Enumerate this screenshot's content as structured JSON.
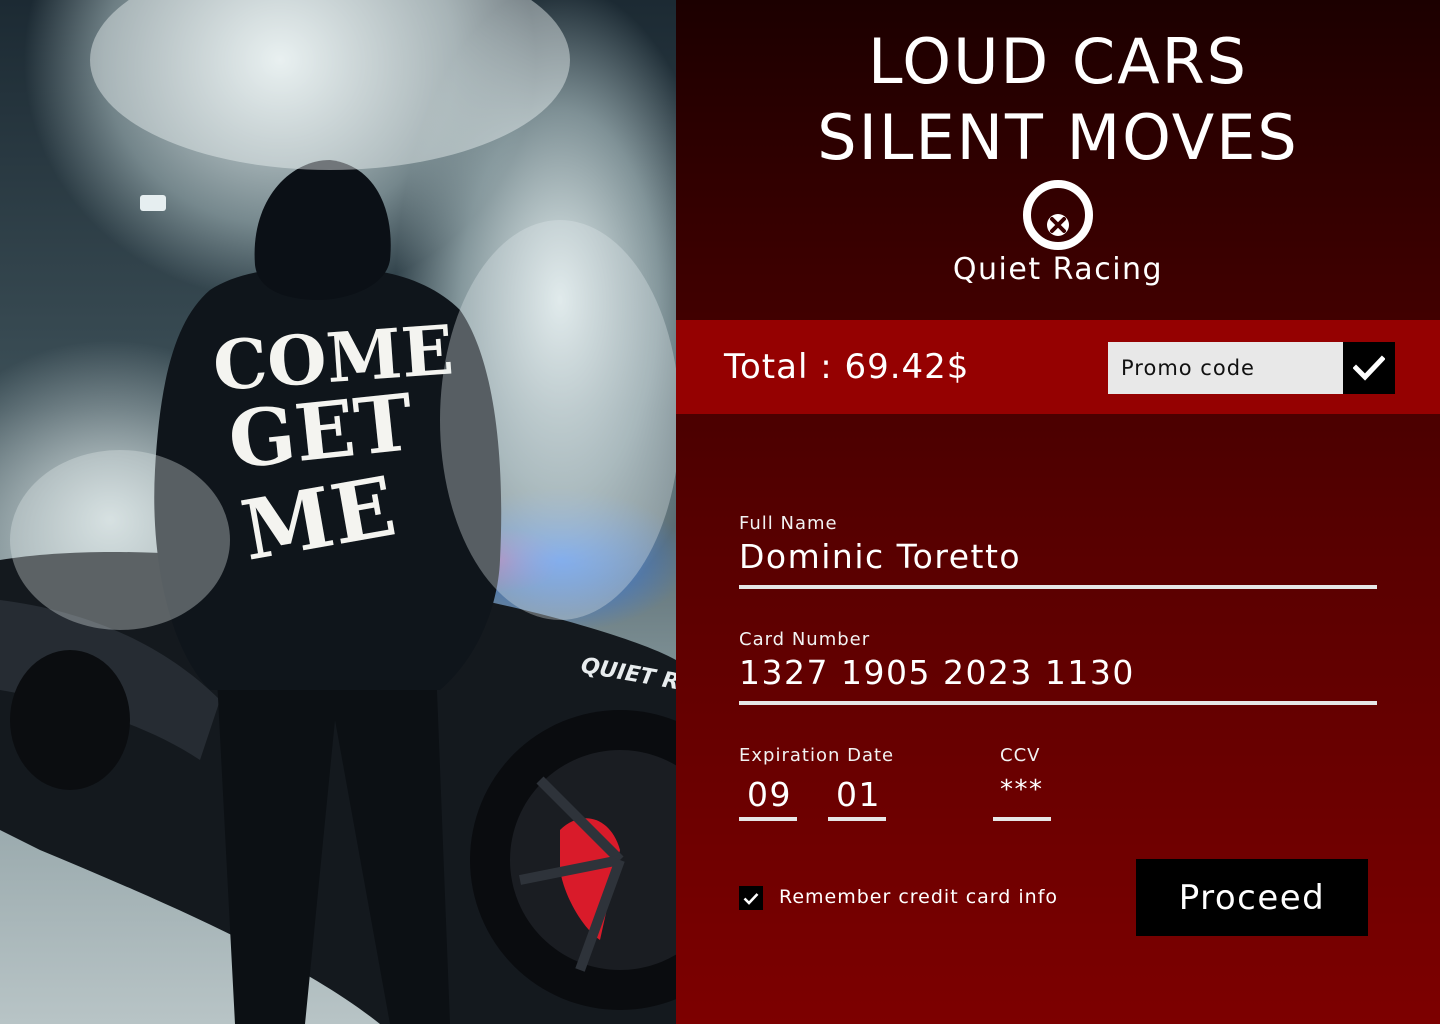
{
  "headline": {
    "line1": "LOUD CARS",
    "line2": "SILENT MOVES"
  },
  "brand": {
    "name": "Quiet Racing",
    "logo_icon": "mouth-x-icon"
  },
  "photo": {
    "hoodie_print": [
      "COME",
      "GET",
      "ME"
    ],
    "car_decal": "QUIET RAC"
  },
  "order": {
    "total_label": "Total : 69.42$"
  },
  "promo": {
    "placeholder": "Promo code",
    "apply_icon": "checkmark-icon"
  },
  "form": {
    "full_name": {
      "label": "Full Name",
      "value": "Dominic Toretto"
    },
    "card_number": {
      "label": "Card Number",
      "value": "1327 1905 2023 1130"
    },
    "expiration": {
      "label": "Expiration Date",
      "month": "09",
      "year": "01"
    },
    "ccv": {
      "label": "CCV",
      "value": "***"
    },
    "remember": {
      "label": "Remember credit card info",
      "checked": true
    },
    "proceed_label": "Proceed"
  },
  "colors": {
    "accent_bar": "#950101",
    "panel_top": "#1c0000",
    "panel_bottom": "#7d0000"
  }
}
